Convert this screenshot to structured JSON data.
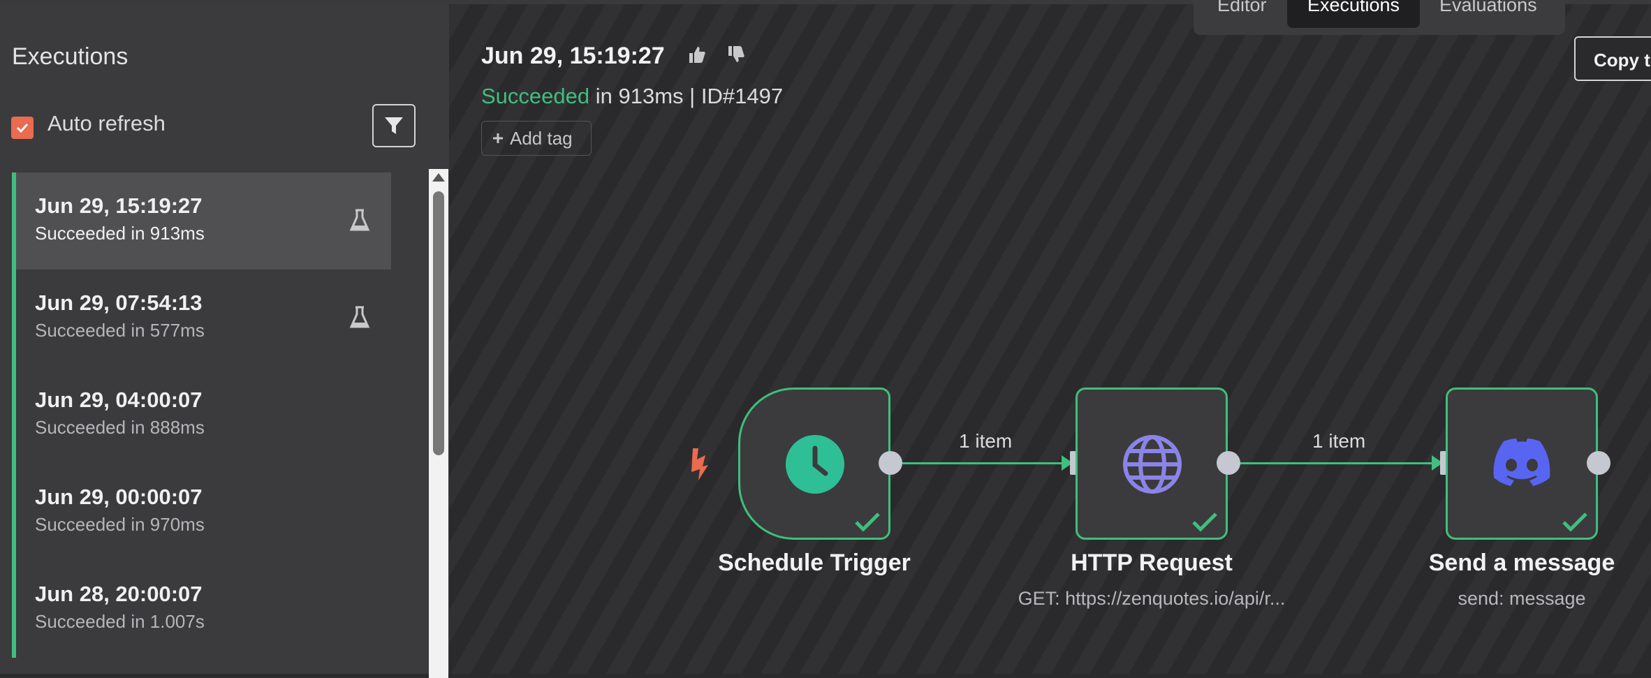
{
  "app": {
    "tabs": [
      {
        "label": "Editor",
        "active": false
      },
      {
        "label": "Executions",
        "active": true
      },
      {
        "label": "Evaluations",
        "active": false
      }
    ]
  },
  "sidebar": {
    "title": "Executions",
    "auto_refresh": {
      "label": "Auto refresh",
      "checked": true
    },
    "filter_icon": "filter-icon",
    "executions": [
      {
        "time": "Jun 29, 15:19:27",
        "status": "Succeeded in 913ms",
        "selected": true,
        "test": true
      },
      {
        "time": "Jun 29, 07:54:13",
        "status": "Succeeded in 577ms",
        "selected": false,
        "test": true
      },
      {
        "time": "Jun 29, 04:00:07",
        "status": "Succeeded in 888ms",
        "selected": false,
        "test": false
      },
      {
        "time": "Jun 29, 00:00:07",
        "status": "Succeeded in 970ms",
        "selected": false,
        "test": false
      },
      {
        "time": "Jun 28, 20:00:07",
        "status": "Succeeded in 1.007s",
        "selected": false,
        "test": false
      }
    ]
  },
  "execution": {
    "title": "Jun 29, 15:19:27",
    "status_word": "Succeeded",
    "duration_text": "in 913ms",
    "separator": "|",
    "id_text": "ID#1497",
    "add_tag": "Add tag",
    "copy_button": "Copy to editor"
  },
  "workflow": {
    "nodes": [
      {
        "name": "Schedule Trigger",
        "subtitle": "",
        "icon": "clock-icon"
      },
      {
        "name": "HTTP Request",
        "subtitle": "GET: https://zenquotes.io/api/r...",
        "icon": "globe-icon"
      },
      {
        "name": "Send a message",
        "subtitle": "send: message",
        "icon": "discord-icon"
      }
    ],
    "connections": [
      {
        "label": "1 item"
      },
      {
        "label": "1 item"
      }
    ]
  },
  "colors": {
    "success": "#3fbf7f",
    "accent": "#ea6b4f",
    "clock": "#2fbf97",
    "globe": "#8b84e8",
    "discord": "#5865f2"
  }
}
